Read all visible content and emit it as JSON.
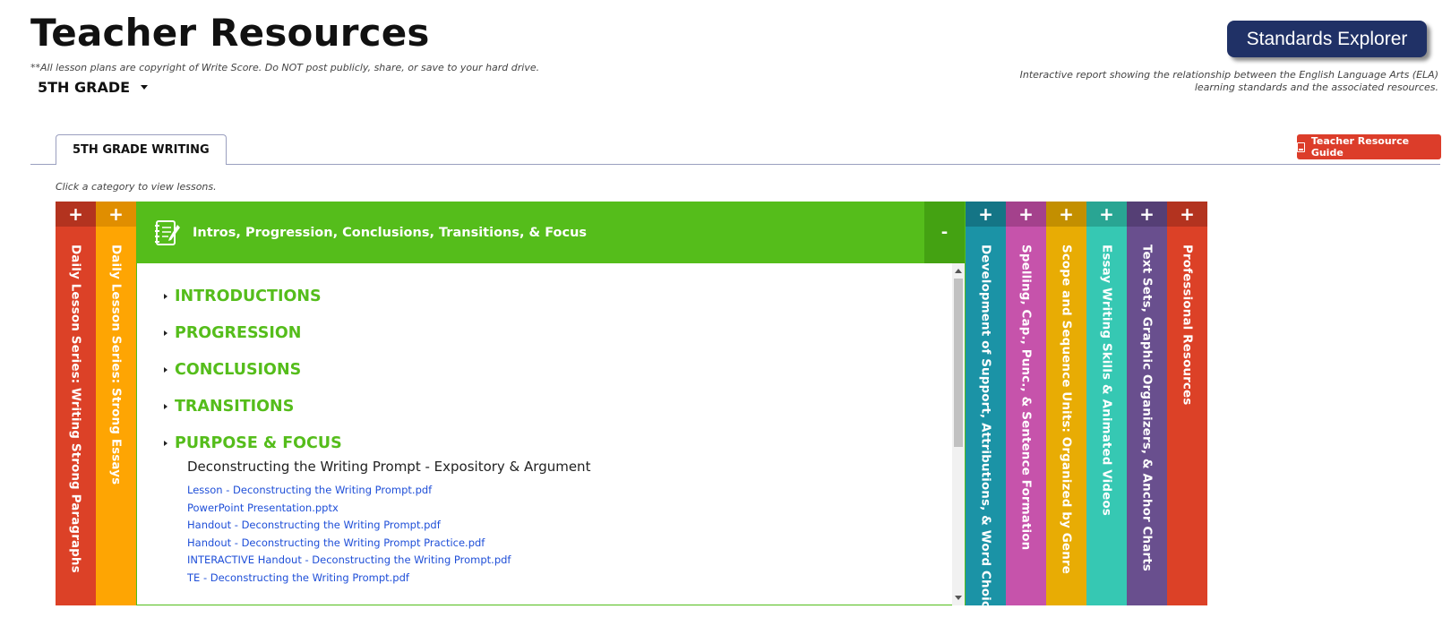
{
  "header": {
    "title": "Teacher Resources",
    "copyright": "**All lesson plans are copyright of Write Score. Do NOT post publicly, share, or save to your hard drive.",
    "grade": "5TH GRADE"
  },
  "standards": {
    "button": "Standards Explorer",
    "description": "Interactive report showing the relationship between the English Language Arts (ELA) learning standards and the associated resources."
  },
  "tabs": [
    {
      "label": "5TH GRADE WRITING"
    }
  ],
  "guide_button": "Teacher Resource Guide",
  "hint": "Click a category to view lessons.",
  "left_columns": [
    {
      "label": "Daily Lesson Series: Writing Strong Paragraphs",
      "color": "#dc4127",
      "header_color": "#b3331f",
      "toggle": "+"
    },
    {
      "label": "Daily Lesson Series: Strong Essays",
      "color": "#fea503",
      "header_color": "#e08e00",
      "toggle": "+"
    }
  ],
  "active_panel": {
    "title": "Intros, Progression, Conclusions, Transitions, & Focus",
    "toggle": "-",
    "color": "#55bd1b",
    "icon": "notebook-pencil-icon",
    "categories": [
      {
        "label": "INTRODUCTIONS"
      },
      {
        "label": "PROGRESSION"
      },
      {
        "label": "CONCLUSIONS"
      },
      {
        "label": "TRANSITIONS"
      },
      {
        "label": "PURPOSE & FOCUS"
      }
    ],
    "open_lesson": {
      "title": "Deconstructing the Writing Prompt - Expository & Argument",
      "files": [
        "Lesson - Deconstructing the Writing Prompt.pdf",
        "PowerPoint Presentation.pptx",
        "Handout - Deconstructing the Writing Prompt.pdf",
        "Handout - Deconstructing the Writing Prompt Practice.pdf",
        "INTERACTIVE Handout - Deconstructing the Writing Prompt.pdf",
        "TE - Deconstructing the Writing Prompt.pdf"
      ]
    }
  },
  "right_columns": [
    {
      "label": "Development of Support, Attributions, & Word Choice",
      "color": "#1b93a6",
      "header_color": "#147586",
      "toggle": "+"
    },
    {
      "label": "Spelling, Cap., Punc., & Sentence Formation",
      "color": "#c653ab",
      "header_color": "#a4418c",
      "toggle": "+"
    },
    {
      "label": "Scope and Sequence Units: Organized by Genre",
      "color": "#e8ac04",
      "header_color": "#c38f00",
      "toggle": "+"
    },
    {
      "label": "Essay Writing Skills & Animated Videos",
      "color": "#36c8b3",
      "header_color": "#29a593",
      "toggle": "+"
    },
    {
      "label": "Text Sets, Graphic Organizers, & Anchor Charts",
      "color": "#694f8e",
      "header_color": "#553f75",
      "toggle": "+"
    },
    {
      "label": "Professional Resources",
      "color": "#dc4127",
      "header_color": "#b3331f",
      "toggle": "+"
    }
  ]
}
